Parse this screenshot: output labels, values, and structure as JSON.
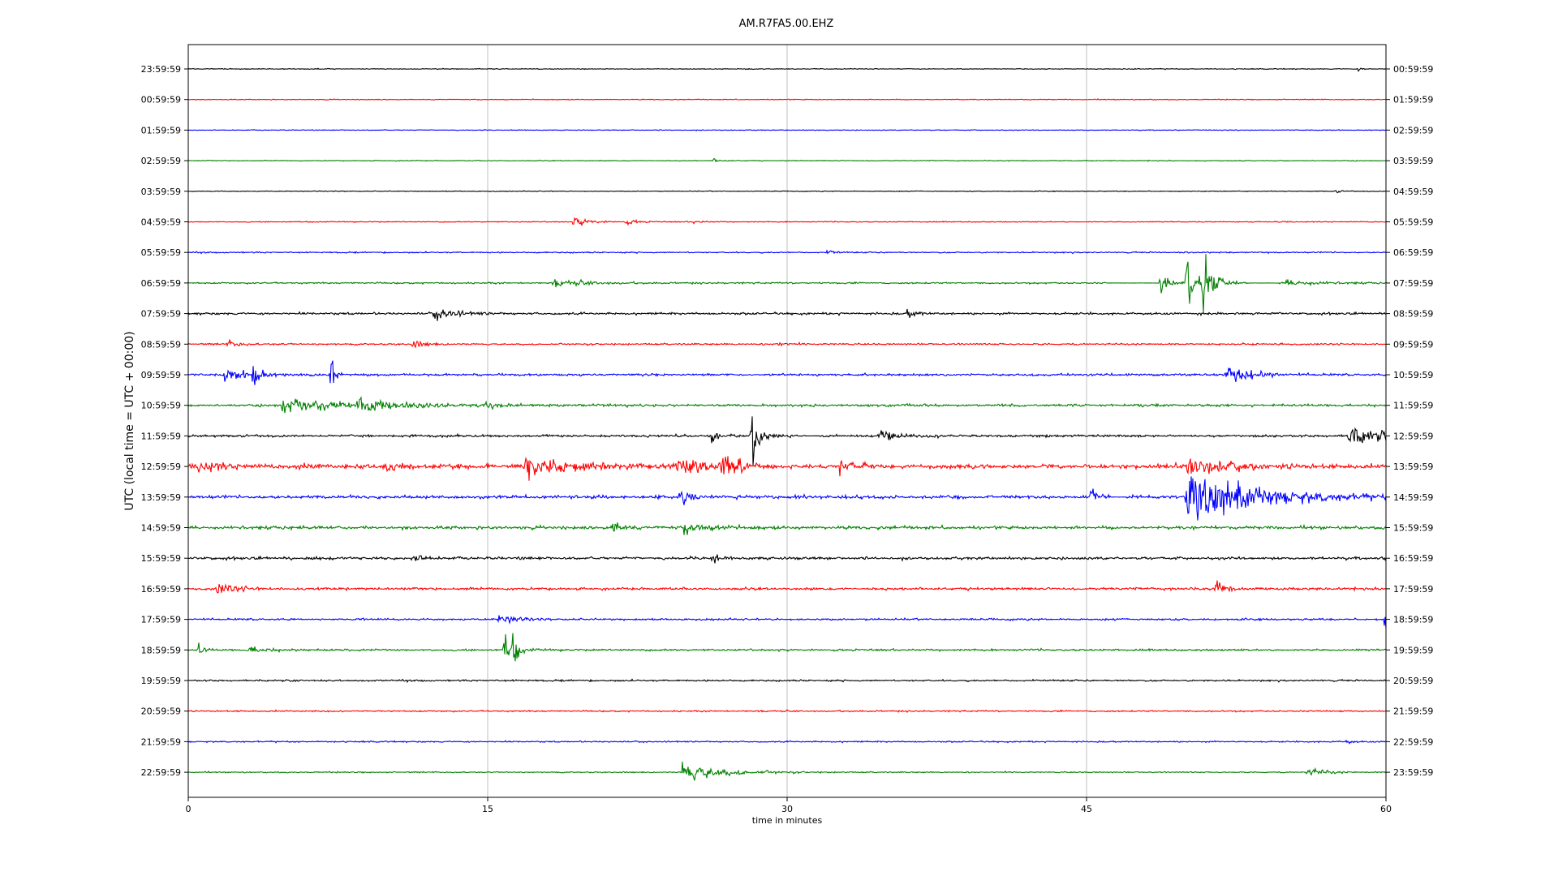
{
  "chart_data": {
    "type": "line",
    "title": "AM.R7FA5.00.EHZ",
    "xlabel": "time in minutes",
    "ylabel": "UTC (local time = UTC + 00:00)",
    "xlim": [
      0,
      60
    ],
    "x_ticks": [
      0,
      15,
      30,
      45,
      60
    ],
    "x_tick_labels": [
      "0",
      "15",
      "30",
      "45",
      "60"
    ],
    "vertical_grid": true,
    "left_labels": [
      "23:59:59",
      "00:59:59",
      "01:59:59",
      "02:59:59",
      "03:59:59",
      "04:59:59",
      "05:59:59",
      "06:59:59",
      "07:59:59",
      "08:59:59",
      "09:59:59",
      "10:59:59",
      "11:59:59",
      "12:59:59",
      "13:59:59",
      "14:59:59",
      "15:59:59",
      "16:59:59",
      "17:59:59",
      "18:59:59",
      "19:59:59",
      "20:59:59",
      "21:59:59",
      "22:59:59"
    ],
    "right_labels": [
      "00:59:59",
      "01:59:59",
      "02:59:59",
      "03:59:59",
      "04:59:59",
      "05:59:59",
      "06:59:59",
      "07:59:59",
      "08:59:59",
      "09:59:59",
      "10:59:59",
      "11:59:59",
      "12:59:59",
      "13:59:59",
      "14:59:59",
      "15:59:59",
      "16:59:59",
      "17:59:59",
      "18:59:59",
      "19:59:59",
      "20:59:59",
      "21:59:59",
      "22:59:59",
      "23:59:59"
    ],
    "colors": [
      "#000000",
      "#ff0000",
      "#0000ff",
      "#008000"
    ],
    "noise": [
      0.6,
      0.6,
      0.6,
      0.6,
      0.6,
      0.7,
      0.9,
      1.1,
      1.6,
      1.3,
      1.6,
      1.8,
      1.7,
      3.0,
      2.2,
      2.2,
      2.0,
      1.8,
      1.4,
      1.4,
      1.2,
      1.0,
      1.0,
      0.9
    ],
    "events": [
      {
        "row": 0,
        "t": 58.6,
        "amp": 3,
        "dur": 0.2
      },
      {
        "row": 3,
        "t": 26.3,
        "amp": 2.5,
        "dur": 0.4
      },
      {
        "row": 4,
        "t": 57.5,
        "amp": 3,
        "dur": 0.2
      },
      {
        "row": 5,
        "t": 19.3,
        "amp": 7,
        "dur": 0.8
      },
      {
        "row": 5,
        "t": 21.9,
        "amp": 4,
        "dur": 0.5
      },
      {
        "row": 5,
        "t": 25.3,
        "amp": 2.5,
        "dur": 0.4
      },
      {
        "row": 6,
        "t": 32.0,
        "amp": 5,
        "dur": 0.3
      },
      {
        "row": 7,
        "t": 18.3,
        "amp": 5,
        "dur": 1.5
      },
      {
        "row": 7,
        "t": 48.7,
        "amp": 28,
        "dur": 0.3
      },
      {
        "row": 7,
        "t": 50.0,
        "amp": 75,
        "dur": 0.3
      },
      {
        "row": 7,
        "t": 50.8,
        "amp": 55,
        "dur": 0.5
      },
      {
        "row": 7,
        "t": 55.0,
        "amp": 4,
        "dur": 1.5
      },
      {
        "row": 8,
        "t": 12.3,
        "amp": 9,
        "dur": 1.0
      },
      {
        "row": 8,
        "t": 36.0,
        "amp": 6,
        "dur": 0.5
      },
      {
        "row": 9,
        "t": 2.0,
        "amp": 6,
        "dur": 0.5
      },
      {
        "row": 9,
        "t": 11.2,
        "amp": 5,
        "dur": 0.6
      },
      {
        "row": 9,
        "t": 29.5,
        "amp": 7,
        "dur": 0.3
      },
      {
        "row": 10,
        "t": 1.8,
        "amp": 10,
        "dur": 1.2
      },
      {
        "row": 10,
        "t": 3.2,
        "amp": 24,
        "dur": 0.3
      },
      {
        "row": 10,
        "t": 7.1,
        "amp": 44,
        "dur": 0.2
      },
      {
        "row": 10,
        "t": 52.0,
        "amp": 16,
        "dur": 1.0
      },
      {
        "row": 11,
        "t": 4.7,
        "amp": 12,
        "dur": 3.5
      },
      {
        "row": 11,
        "t": 8.5,
        "amp": 10,
        "dur": 1.0
      },
      {
        "row": 11,
        "t": 14.8,
        "amp": 7,
        "dur": 0.5
      },
      {
        "row": 12,
        "t": 26.2,
        "amp": 18,
        "dur": 0.3
      },
      {
        "row": 12,
        "t": 28.2,
        "amp": 52,
        "dur": 0.3
      },
      {
        "row": 12,
        "t": 34.6,
        "amp": 9,
        "dur": 0.8
      },
      {
        "row": 12,
        "t": 58.0,
        "amp": 14,
        "dur": 2.0
      },
      {
        "row": 13,
        "t": 0.5,
        "amp": 10,
        "dur": 1.0
      },
      {
        "row": 13,
        "t": 9.8,
        "amp": 14,
        "dur": 0.5
      },
      {
        "row": 13,
        "t": 16.8,
        "amp": 16,
        "dur": 2.5
      },
      {
        "row": 13,
        "t": 24.5,
        "amp": 13,
        "dur": 1.5
      },
      {
        "row": 13,
        "t": 26.6,
        "amp": 18,
        "dur": 0.8
      },
      {
        "row": 13,
        "t": 32.5,
        "amp": 10,
        "dur": 0.8
      },
      {
        "row": 13,
        "t": 50.0,
        "amp": 18,
        "dur": 1.5
      },
      {
        "row": 14,
        "t": 24.6,
        "amp": 9,
        "dur": 0.5
      },
      {
        "row": 14,
        "t": 45.2,
        "amp": 18,
        "dur": 0.3
      },
      {
        "row": 14,
        "t": 50.0,
        "amp": 46,
        "dur": 3.2
      },
      {
        "row": 15,
        "t": 21.2,
        "amp": 11,
        "dur": 0.5
      },
      {
        "row": 15,
        "t": 24.8,
        "amp": 8,
        "dur": 1.2
      },
      {
        "row": 16,
        "t": 11.2,
        "amp": 7,
        "dur": 0.5
      },
      {
        "row": 16,
        "t": 26.2,
        "amp": 11,
        "dur": 0.3
      },
      {
        "row": 17,
        "t": 1.4,
        "amp": 10,
        "dur": 0.8
      },
      {
        "row": 17,
        "t": 51.5,
        "amp": 20,
        "dur": 0.3
      },
      {
        "row": 18,
        "t": 15.5,
        "amp": 8,
        "dur": 0.8
      },
      {
        "row": 18,
        "t": 59.9,
        "amp": 16,
        "dur": 0.2
      },
      {
        "row": 19,
        "t": 0.5,
        "amp": 18,
        "dur": 0.2
      },
      {
        "row": 19,
        "t": 3.0,
        "amp": 7,
        "dur": 0.8
      },
      {
        "row": 19,
        "t": 15.8,
        "amp": 32,
        "dur": 0.3
      },
      {
        "row": 19,
        "t": 16.2,
        "amp": 26,
        "dur": 0.3
      },
      {
        "row": 22,
        "t": 58.0,
        "amp": 3,
        "dur": 0.3
      },
      {
        "row": 23,
        "t": 24.7,
        "amp": 17,
        "dur": 1.8
      },
      {
        "row": 23,
        "t": 56.0,
        "amp": 7,
        "dur": 0.8
      }
    ],
    "gaps": [
      {
        "row": 3,
        "from": 23.3,
        "to": 23.6
      },
      {
        "row": 3,
        "from": 25.5,
        "to": 26.0
      },
      {
        "row": 3,
        "from": 28.8,
        "to": 29.6
      },
      {
        "row": 7,
        "from": 46.0,
        "to": 48.5
      },
      {
        "row": 7,
        "from": 53.1,
        "to": 54.5
      },
      {
        "row": 12,
        "from": 30.9,
        "to": 31.6
      },
      {
        "row": 14,
        "from": 46.2,
        "to": 47.0
      }
    ]
  }
}
